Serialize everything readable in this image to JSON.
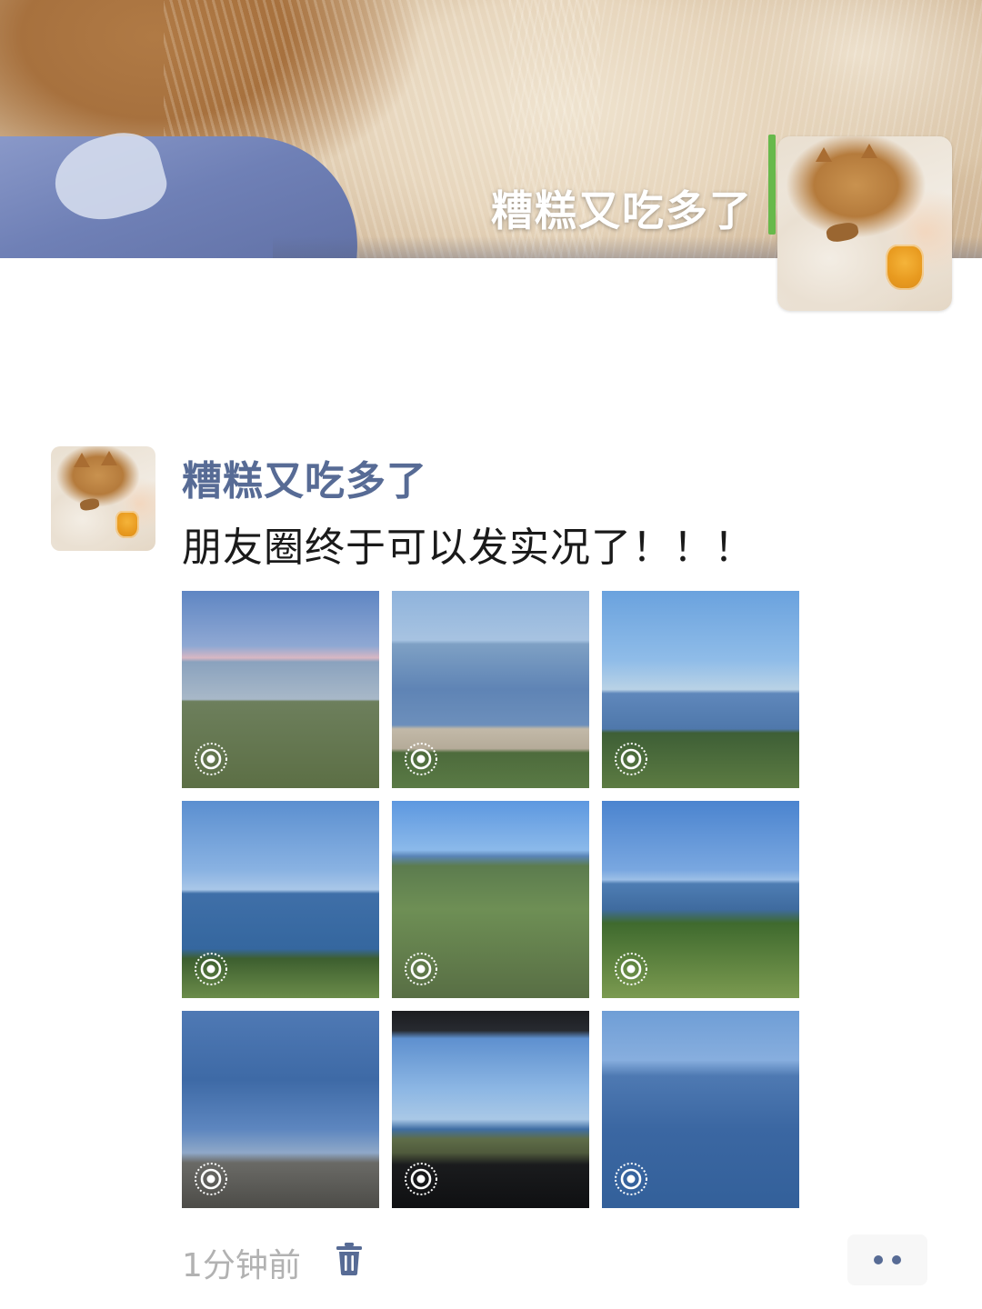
{
  "profile": {
    "name": "糟糕又吃多了"
  },
  "post": {
    "author": "糟糕又吃多了",
    "text": "朋友圈终于可以发实况了！！！",
    "photo_count": 9,
    "photos_live": true,
    "time": "1分钟前"
  },
  "colors": {
    "name_link": "#576b95",
    "body_text": "#1a1a1a",
    "meta_text": "#b2b2b2",
    "more_button_bg": "#f7f7f7"
  },
  "icons": {
    "live_photo": "live-photo-icon",
    "delete": "trash-icon",
    "more": "more-dots-icon"
  }
}
